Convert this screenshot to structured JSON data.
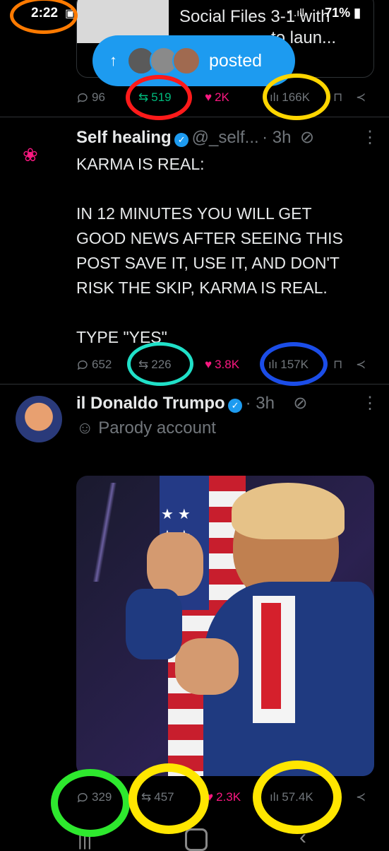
{
  "status": {
    "time": "2:22",
    "battery": "71%"
  },
  "prev_card": {
    "line1": "Social Files 3-1 with",
    "line2": "to laun..."
  },
  "posted_pill": {
    "label": "posted"
  },
  "tweet1": {
    "replies": "96",
    "reposts": "519",
    "likes": "2K",
    "views": "166K"
  },
  "tweet2": {
    "name": "Self healing",
    "handle": "@_self...",
    "time": "· 3h",
    "text": "KARMA IS REAL:\n\nIN 12 MINUTES YOU WILL GET\nGOOD NEWS AFTER SEEING THIS\nPOST SAVE IT, USE IT, AND DON'T\nRISK THE SKIP, KARMA IS REAL.\n\nTYPE \"YES\"",
    "replies": "652",
    "reposts": "226",
    "likes": "3.8K",
    "views": "157K"
  },
  "tweet3": {
    "name": "il Donaldo Trumpo",
    "time": "· 3h",
    "label": "Parody account",
    "replies": "329",
    "reposts": "457",
    "likes": "2.3K",
    "views": "57.4K"
  },
  "colors": {
    "accent": "#1d9bf0",
    "repost_green": "#00ba7c",
    "like_pink": "#f91880"
  }
}
